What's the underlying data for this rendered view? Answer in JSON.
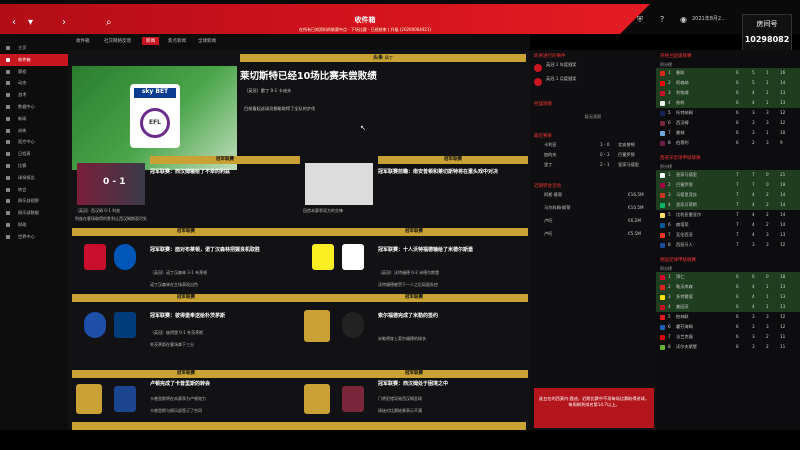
{
  "header": {
    "title": "收件箱",
    "subtitle": "在所有已知资料的联赛中点 · 下场比赛 · 已经结束 | 升级 (20200064421)",
    "date": "2021年8月2...",
    "stream_name": "房间号",
    "stream_id": "10298082"
  },
  "sidebar": {
    "items": [
      {
        "label": "主页"
      },
      {
        "label": "收件箱",
        "active": true
      },
      {
        "label": "赛程"
      },
      {
        "label": "动态"
      },
      {
        "label": "战术"
      },
      {
        "label": "数据中心"
      },
      {
        "label": "新闻"
      },
      {
        "label": "训练"
      },
      {
        "label": "医疗中心"
      },
      {
        "label": "日程表"
      },
      {
        "label": "比赛"
      },
      {
        "label": "球探报告"
      },
      {
        "label": "转会"
      },
      {
        "label": "俱乐部视野"
      },
      {
        "label": "俱乐部数据"
      },
      {
        "label": "财政"
      },
      {
        "label": "世界中心"
      }
    ]
  },
  "tabs": [
    {
      "label": "收件箱"
    },
    {
      "label": "社交网络反馈"
    },
    {
      "label": "新闻",
      "active": true
    },
    {
      "label": "焦点新闻"
    },
    {
      "label": "全球新闻"
    }
  ],
  "headline": {
    "section": "头条",
    "tag": "精丁",
    "title": "莱切斯特已经10场比赛未尝败绩",
    "points": [
      "（英冠）雷丁 0-1 卡迪夫",
      "目前看起这球员都能取得了全队的步伐"
    ]
  },
  "cards": [
    {
      "hdr": "冠军联赛",
      "title": "冠军联赛：西汉姆输给了不幸的利兹",
      "lines": [
        "（英冠）西汉姆 0-1 利兹",
        "利兹在客场取得的胜利让西汉姆颜面尽失"
      ],
      "img": "0 - 1"
    },
    {
      "hdr": "冠军联赛",
      "title": "冠军联赛前瞻：南安普顿和莱切斯特将在重头戏中对决",
      "lines": [
        "回首本赛季双方的交锋"
      ]
    },
    {
      "hdr": "冠军联赛",
      "title": "冠军联赛：面对布莱顿，诺丁汉森林把握良机取胜",
      "lines": [
        "（英冠）诺丁汉森林 3-1 布莱顿",
        "诺丁汉森林在主场表现出色"
      ]
    },
    {
      "hdr": "冠军联赛",
      "title": "冠军联赛：十人沃特福德输给了米德尔斯堡",
      "lines": [
        "（英冠）沃特福德 0-2 米德尔斯堡",
        "沃特福德被罚下一人之后局面失控"
      ]
    },
    {
      "hdr": "冠军联赛",
      "title": "冠军联赛：彼得堡奉送给朴茨茅斯",
      "lines": [
        "（英冠）彼得堡 0-1 朴茨茅斯",
        "朴茨茅斯在客场拿下三分"
      ]
    },
    {
      "hdr": "冠军联赛",
      "title": "索尔福德完成了米勒的签约",
      "lines": [
        "米勒将穿上索尔福德的球衣"
      ]
    },
    {
      "hdr": "冠军联赛",
      "title": "卢顿完成了卡普里斯的转会",
      "lines": [
        "卡普里斯将在本赛季为卢顿效力",
        "卡普里斯与俱乐部签订了合同"
      ]
    },
    {
      "hdr": "冠军联赛",
      "title": "冠军联赛：西汉姆处于困境之中",
      "lines": [
        "门将犯错导致西汉姆丢球",
        "球迷对比赛结果表示不满"
      ]
    }
  ],
  "right": {
    "sec1": "即将进行的事件",
    "events": [
      "英冠 1 年度颁奖",
      "英冠 1 月度颁奖"
    ],
    "sec2": "经理观察",
    "note": "暂无观察",
    "sec3": "最近赛果",
    "results": [
      {
        "h": "卡利亚",
        "s": "1 - 0",
        "a": "北安普顿"
      },
      {
        "h": "加的夫",
        "s": "0 - 3",
        "a": "巴塞罗那"
      },
      {
        "h": "里丁",
        "s": "2 - 1",
        "a": "皇家马德里"
      }
    ],
    "sec4": "近期转会活动",
    "transfers": [
      {
        "n": "阿斯·基恩",
        "f": "€16.5M"
      },
      {
        "n": "马尔科姆·斯蒂",
        "f": "€10.5M"
      },
      {
        "n": "卢旺",
        "f": "€6.2M"
      },
      {
        "n": "卢旺",
        "f": "€5.5M"
      }
    ],
    "foot": "谁五在的西莫内·鹿迪，近期比赛中不再每场比赛取得进球，每周刷到排名第14.7以上。"
  },
  "tables": [
    {
      "name": "英格兰超级联赛",
      "sub": "积分榜",
      "rows": [
        [
          "1",
          "曼联",
          "6",
          "5",
          "1",
          "16"
        ],
        [
          "2",
          "阿森纳",
          "6",
          "5",
          "1",
          "14"
        ],
        [
          "3",
          "利物浦",
          "6",
          "4",
          "1",
          "13"
        ],
        [
          "4",
          "热刺",
          "6",
          "4",
          "1",
          "13"
        ],
        [
          "5",
          "托特纳姆",
          "6",
          "3",
          "3",
          "12"
        ],
        [
          "6",
          "西汉姆",
          "6",
          "3",
          "3",
          "12"
        ],
        [
          "7",
          "曼城",
          "6",
          "3",
          "1",
          "10"
        ],
        [
          "8",
          "伯恩利",
          "6",
          "2",
          "3",
          "9"
        ]
      ]
    },
    {
      "name": "西班牙足球甲级联赛",
      "sub": "积分榜",
      "rows": [
        [
          "1",
          "皇家马德里",
          "7",
          "7",
          "0",
          "21"
        ],
        [
          "2",
          "巴塞罗那",
          "7",
          "7",
          "0",
          "19"
        ],
        [
          "3",
          "马德里竞技",
          "7",
          "4",
          "2",
          "14"
        ],
        [
          "4",
          "皇家贝蒂斯",
          "7",
          "4",
          "2",
          "14"
        ],
        [
          "5",
          "比利亚雷亚尔",
          "7",
          "4",
          "2",
          "14"
        ],
        [
          "6",
          "赫塔菲",
          "7",
          "4",
          "2",
          "14"
        ],
        [
          "7",
          "瓦伦西亚",
          "7",
          "4",
          "3",
          "13"
        ],
        [
          "8",
          "西班牙人",
          "7",
          "3",
          "3",
          "12"
        ]
      ]
    },
    {
      "name": "德国足球甲级联赛",
      "sub": "积分榜",
      "rows": [
        [
          "1",
          "拜仁",
          "6",
          "6",
          "0",
          "18"
        ],
        [
          "2",
          "勒沃库森",
          "6",
          "4",
          "1",
          "13"
        ],
        [
          "3",
          "多特蒙德",
          "6",
          "4",
          "1",
          "13"
        ],
        [
          "4",
          "美因茨",
          "6",
          "4",
          "1",
          "13"
        ],
        [
          "5",
          "柏林联",
          "6",
          "3",
          "3",
          "12"
        ],
        [
          "6",
          "霍芬海姆",
          "6",
          "3",
          "3",
          "12"
        ],
        [
          "7",
          "法兰克福",
          "6",
          "3",
          "2",
          "11"
        ],
        [
          "8",
          "沃尔夫斯堡",
          "6",
          "3",
          "2",
          "11"
        ]
      ]
    }
  ],
  "colors": {
    "accent": "#c9151e",
    "gold": "#c9a233"
  }
}
